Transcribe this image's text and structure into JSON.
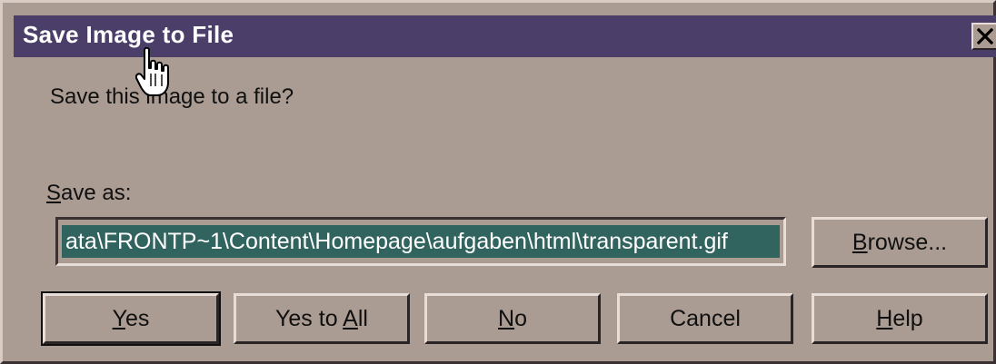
{
  "window": {
    "title": "Save Image to File",
    "close_icon": "close-icon"
  },
  "prompt": "Save this image to a file?",
  "save_as": {
    "label_mnemonic": "S",
    "label_rest": "ave as:",
    "path_value": "ata\\FRONTP~1\\Content\\Homepage\\aufgaben\\html\\transparent.gif"
  },
  "buttons": {
    "browse": {
      "mnemonic": "B",
      "rest": "rowse..."
    },
    "yes": {
      "mnemonic": "Y",
      "rest": "es"
    },
    "yes_to_all": {
      "prefix": "Yes to ",
      "mnemonic": "A",
      "rest": "ll"
    },
    "no": {
      "mnemonic": "N",
      "rest": "o"
    },
    "cancel": {
      "label": "Cancel"
    },
    "help": {
      "mnemonic": "H",
      "rest": "elp"
    }
  },
  "cursor": {
    "icon": "hand-pointer-icon"
  },
  "colors": {
    "title_bar": "#4b3f69",
    "dialog_face": "#ab9c93",
    "selection": "#31645e"
  }
}
